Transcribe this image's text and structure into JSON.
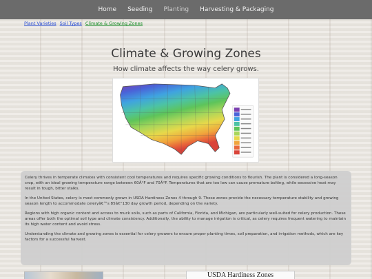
{
  "nav": {
    "items": [
      {
        "label": "Home",
        "active": false
      },
      {
        "label": "Seeding",
        "active": false
      },
      {
        "label": "Planting",
        "active": true
      },
      {
        "label": "Harvesting & Packaging",
        "active": false
      }
    ]
  },
  "breadcrumb": {
    "items": [
      "Plant Varieties",
      "Soil Types",
      "Climate & Growing Zones"
    ]
  },
  "header": {
    "title": "Climate & Growing Zones",
    "subtitle": "How climate affects the way celery grows."
  },
  "map": {
    "icon": "usa-hardiness-zone-map",
    "zone_colors": [
      "#7a3fb0",
      "#4a63d8",
      "#3fa3e0",
      "#4cc3a5",
      "#5ec45a",
      "#a9d65a",
      "#e7d84a",
      "#f0a53c",
      "#e8683a",
      "#d9443a"
    ]
  },
  "content": {
    "paragraphs": [
      "Celery thrives in temperate climates with consistent cool temperatures and requires specific growing conditions to flourish. The plant is considered a long-season crop, with an ideal growing temperature range between 60Â°F and 70Â°F. Temperatures that are too low can cause premature bolting, while excessive heat may result in tough, bitter stalks.",
      "In the United States, celery is most commonly grown in USDA Hardiness Zones 4 through 9. These zones provide the necessary temperature stability and growing season length to accommodate celeryâ€™s 85â€“130 day growth period, depending on the variety.",
      "Regions with high organic content and access to muck soils, such as parts of California, Florida, and Michigan, are particularly well-suited for celery production. These areas offer both the optimal soil type and climate consistency. Additionally, the ability to manage irrigation is critical, as celery requires frequent watering to maintain its high water content and avoid stress.",
      "Understanding the climate and growing zones is essential for celery growers to ensure proper planting times, soil preparation, and irrigation methods, which are key factors for a successful harvest."
    ]
  },
  "thumbnails": {
    "right_title": "USDA Hardiness Zones"
  }
}
